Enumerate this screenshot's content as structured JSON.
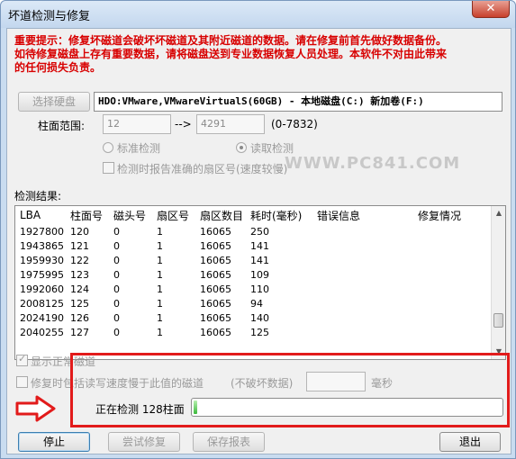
{
  "window": {
    "title": "坏道检测与修复",
    "close_glyph": "✕"
  },
  "warning": {
    "line1": "重要提示：修复坏磁道会破坏坏磁道及其附近磁道的数据。请在修复前首先做好数据备份。",
    "line2": "如待修复磁盘上存有重要数据，请将磁盘送到专业数据恢复人员处理。本软件不对由此带来",
    "line3": "的任何损失负责。"
  },
  "disk": {
    "select_button": "选择硬盘",
    "selected": "HDO:VMware,VMwareVirtualS(60GB) - 本地磁盘(C:) 新加卷(F:)"
  },
  "cylinder": {
    "label": "柱面范围:",
    "from": "12",
    "arrow": "-->",
    "to": "4291",
    "range": "(0-7832)"
  },
  "options": {
    "standard_check": "标准检测",
    "read_check": "读取检测",
    "report_sectors": "检测时报告准确的扇区号(速度较慢)"
  },
  "results": {
    "label": "检测结果:",
    "columns": [
      "LBA",
      "柱面号",
      "磁头号",
      "扇区号",
      "扇区数目",
      "耗时(毫秒)",
      "错误信息",
      "修复情况"
    ],
    "rows": [
      [
        "1927800",
        "120",
        "0",
        "1",
        "16065",
        "250",
        "",
        ""
      ],
      [
        "1943865",
        "121",
        "0",
        "1",
        "16065",
        "141",
        "",
        ""
      ],
      [
        "1959930",
        "122",
        "0",
        "1",
        "16065",
        "141",
        "",
        ""
      ],
      [
        "1975995",
        "123",
        "0",
        "1",
        "16065",
        "109",
        "",
        ""
      ],
      [
        "1992060",
        "124",
        "0",
        "1",
        "16065",
        "110",
        "",
        ""
      ],
      [
        "2008125",
        "125",
        "0",
        "1",
        "16065",
        "94",
        "",
        ""
      ],
      [
        "2024190",
        "126",
        "0",
        "1",
        "16065",
        "140",
        "",
        ""
      ],
      [
        "2040255",
        "127",
        "0",
        "1",
        "16065",
        "125",
        "",
        ""
      ]
    ]
  },
  "watermark": "WWW.PC841.COM",
  "show_normal": "显示正常磁道",
  "repair_option": {
    "text": "修复时包括读写速度慢于此值的磁道",
    "suffix": "(不破坏数据)",
    "unit": "毫秒"
  },
  "status": {
    "text": "正在检测  128柱面",
    "progress": 0.012
  },
  "buttons": {
    "stop": "停止",
    "try_repair": "尝试修复",
    "save_report": "保存报表",
    "exit": "退出"
  },
  "colors": {
    "warning": "#d80000",
    "highlight": "#e21b1b",
    "progress": "#3cb93c"
  }
}
